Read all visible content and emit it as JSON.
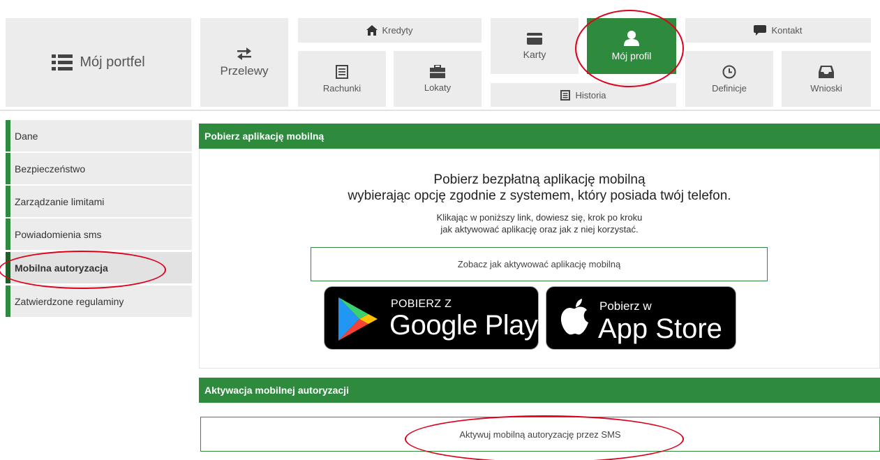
{
  "nav": {
    "portfel": "Mój portfel",
    "przelewy": "Przelewy",
    "kredyty": "Kredyty",
    "rachunki": "Rachunki",
    "lokaty": "Lokaty",
    "karty": "Karty",
    "moj_profil": "Mój profil",
    "historia": "Historia",
    "kontakt": "Kontakt",
    "definicje": "Definicje",
    "wnioski": "Wnioski"
  },
  "sidebar": {
    "items": [
      {
        "label": "Dane"
      },
      {
        "label": "Bezpieczeństwo"
      },
      {
        "label": "Zarządzanie limitami"
      },
      {
        "label": "Powiadomienia sms"
      },
      {
        "label": "Mobilna autoryzacja",
        "active": true
      },
      {
        "label": "Zatwierdzone regulaminy"
      }
    ]
  },
  "download_panel": {
    "title": "Pobierz aplikację mobilną",
    "heading_line1": "Pobierz bezpłatną aplikację mobilną",
    "heading_line2": "wybierając opcję zgodnie z systemem, który posiada twój telefon.",
    "info_line1": "Klikając w poniższy link, dowiesz się, krok po kroku",
    "info_line2": "jak aktywować aplikację oraz jak z niej korzystać.",
    "link_label": "Zobacz jak aktywować aplikację mobilną",
    "google_play_small": "POBIERZ Z",
    "google_play_big": "Google Play",
    "app_store_small": "Pobierz w",
    "app_store_big": "App Store"
  },
  "activation_panel": {
    "title": "Aktywacja mobilnej autoryzacji",
    "button_label": "Aktywuj mobilną autoryzację przez SMS"
  },
  "colors": {
    "accent": "#2e8b3e",
    "tile_bg": "#ececec",
    "highlight": "#e0001a"
  }
}
